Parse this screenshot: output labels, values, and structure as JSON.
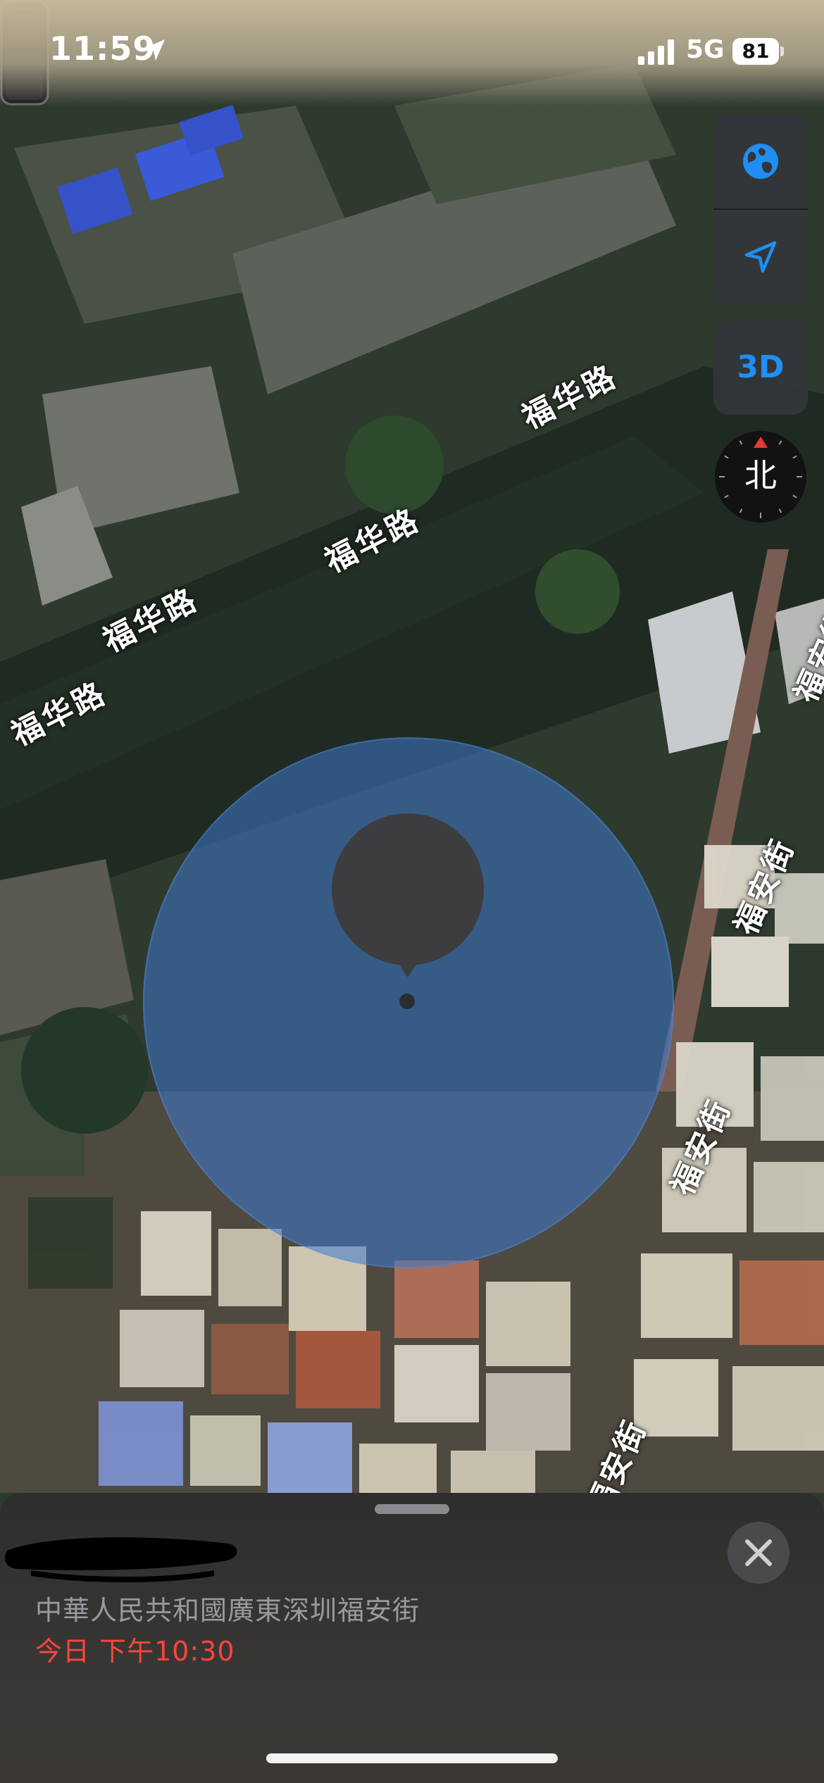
{
  "status_bar": {
    "time": "11:59",
    "network": "5G",
    "battery": "81",
    "location_icon": "location-arrow-icon",
    "signal_icon": "cellular-signal-icon"
  },
  "map": {
    "type": "satellite",
    "road_labels": [
      "福华路",
      "福华路",
      "福华路",
      "福华路",
      "福安街",
      "福安街",
      "福安街",
      "福安街"
    ]
  },
  "controls": {
    "map_mode_icon": "globe-icon",
    "locate_icon": "location-arrow-icon",
    "three_d_label": "3D",
    "compass_label": "北"
  },
  "device": {
    "pin_icon": "iphone-icon",
    "name": "",
    "address": "中華人民共和國廣東深圳福安街",
    "last_seen": "今日 下午10:30",
    "accent_color": "#1f8ff5",
    "timestamp_color": "#ff453a"
  },
  "sheet": {
    "close_icon": "close-icon"
  }
}
